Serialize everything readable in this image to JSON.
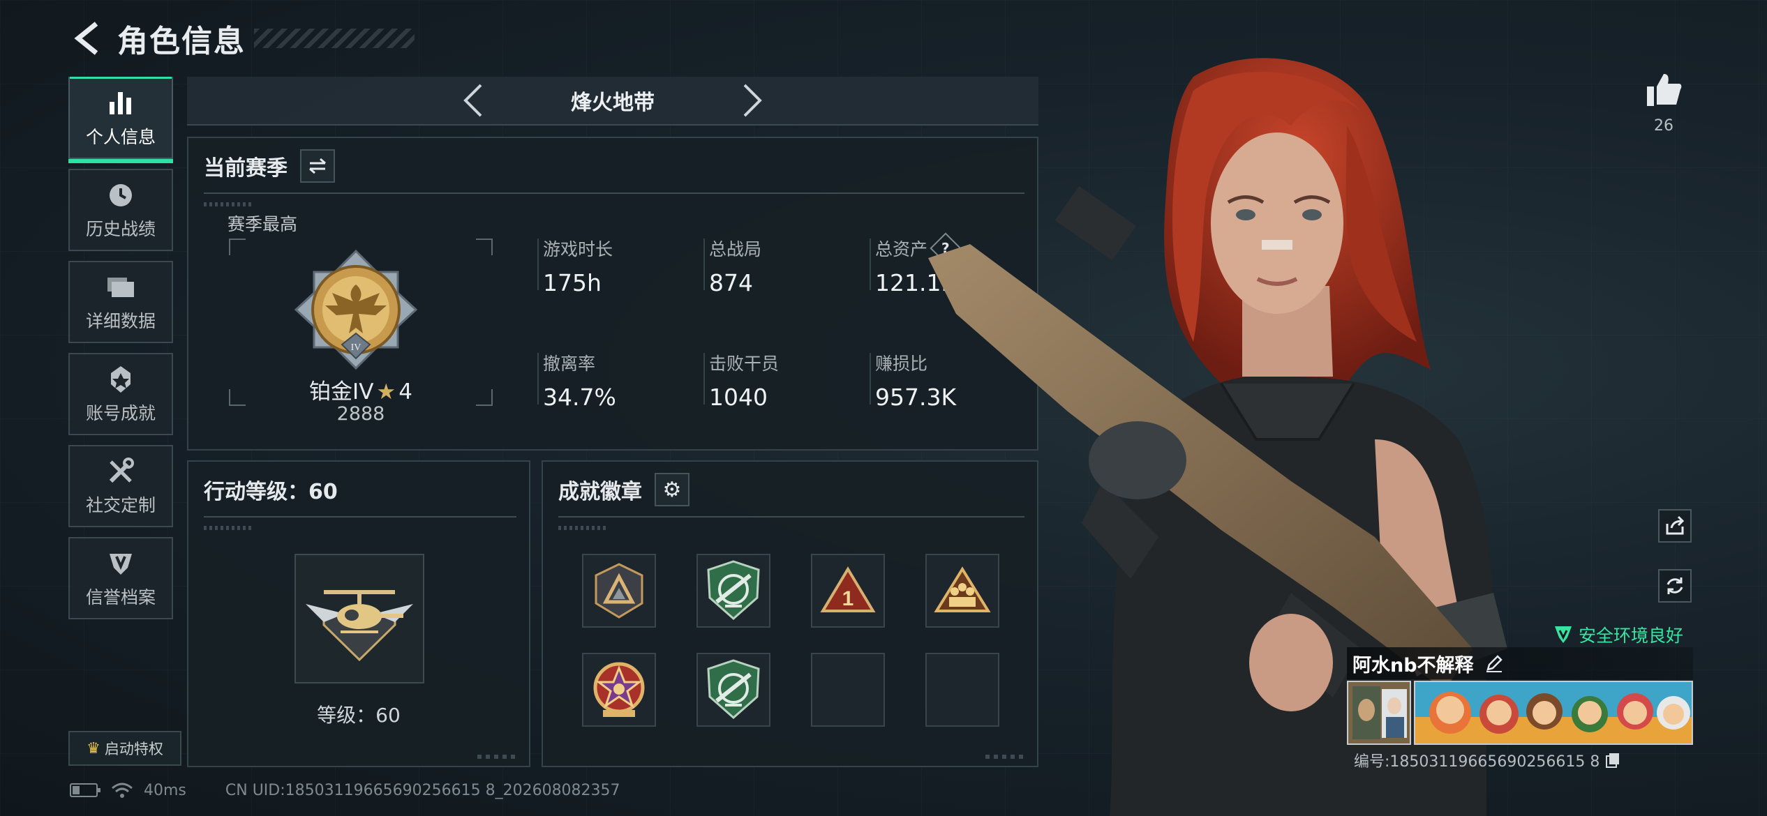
{
  "header": {
    "title": "角色信息"
  },
  "sidebar": {
    "items": [
      {
        "label": "个人信息",
        "icon": "bar-chart-icon",
        "active": true
      },
      {
        "label": "历史战绩",
        "icon": "clock-icon"
      },
      {
        "label": "详细数据",
        "icon": "folder-icon"
      },
      {
        "label": "账号成就",
        "icon": "achievement-icon"
      },
      {
        "label": "社交定制",
        "icon": "wrench-icon"
      },
      {
        "label": "信誉档案",
        "icon": "shield-icon"
      }
    ],
    "privilege_label": "启动特权"
  },
  "mode": {
    "title": "烽火地带"
  },
  "season": {
    "title": "当前赛季",
    "best_label": "赛季最高",
    "rank_name": "铂金IV",
    "rank_stars": "4",
    "rank_score": "2888",
    "stats": [
      {
        "label": "游戏时长",
        "value": "175h"
      },
      {
        "label": "总战局",
        "value": "874"
      },
      {
        "label": "总资产",
        "value": "121.1M",
        "help": "?"
      },
      {
        "label": "撤离率",
        "value": "34.7%"
      },
      {
        "label": "击败干员",
        "value": "1040"
      },
      {
        "label": "赚损比",
        "value": "957.3K"
      }
    ]
  },
  "level": {
    "title": "行动等级：60",
    "label": "等级：60"
  },
  "achievements": {
    "title": "成就徽章",
    "filled_count": 6,
    "slot_count": 8
  },
  "status": {
    "ping": "40ms",
    "uid": "CN UID:18503119665690256615 8_202608082357"
  },
  "profile": {
    "likes": "26",
    "safety_text": "安全环境良好",
    "player_name": "阿水nb不解释",
    "player_id": "编号:18503119665690256615 8"
  },
  "colors": {
    "accent": "#2fe0a4",
    "safety": "#37e5a2",
    "gold": "#d2b060"
  }
}
